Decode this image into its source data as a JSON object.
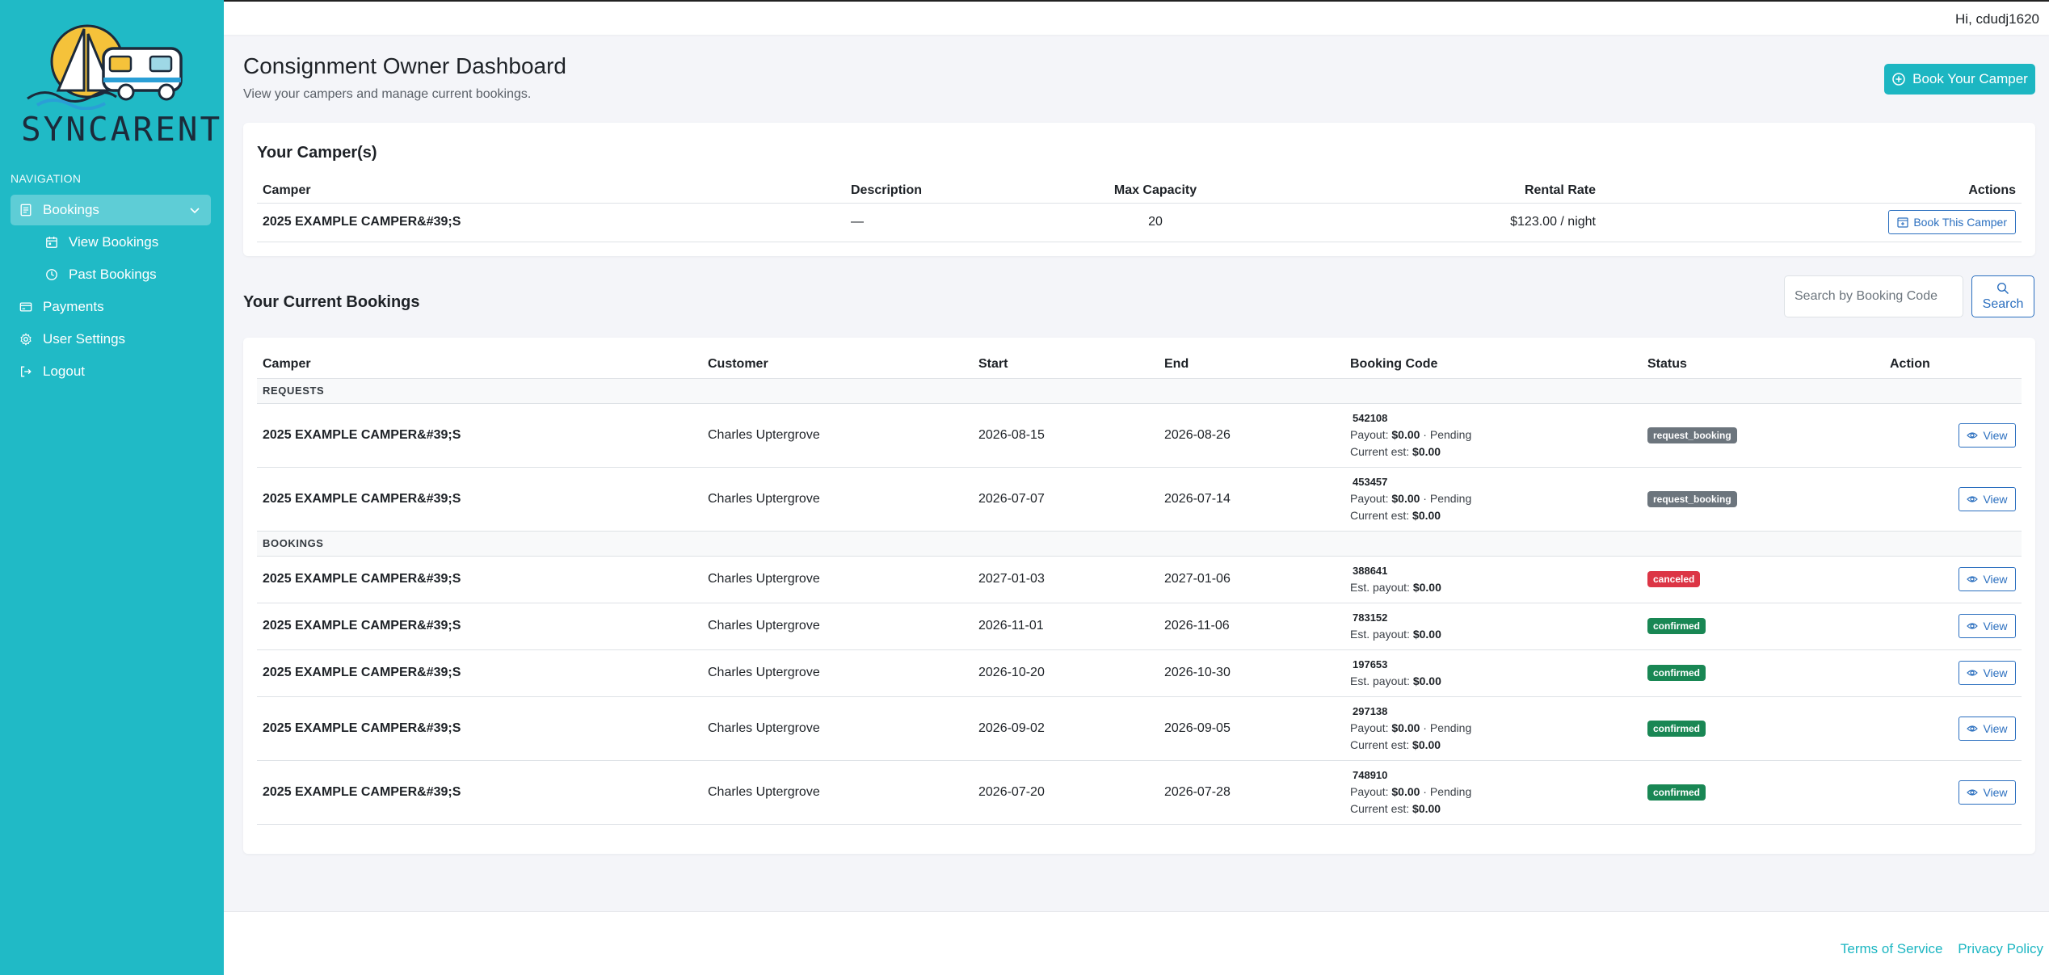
{
  "app": {
    "logo_text": "SYNCARENT",
    "greeting": "Hi, cdudj1620"
  },
  "colors": {
    "sidebar": "#20bac6",
    "accent": "#1cb6c2",
    "link_outline": "#2b6fbf",
    "status_request": "#6c757d",
    "status_canceled": "#dc3545",
    "status_confirmed": "#198754"
  },
  "sidebar": {
    "heading": "NAVIGATION",
    "items": [
      {
        "label": "Bookings",
        "icon": "bookings-icon",
        "active": true,
        "expanded": true
      },
      {
        "label": "View Bookings",
        "icon": "calendar-icon",
        "sub": true
      },
      {
        "label": "Past Bookings",
        "icon": "clock-icon",
        "sub": true
      },
      {
        "label": "Payments",
        "icon": "credit-card-icon"
      },
      {
        "label": "User Settings",
        "icon": "gear-icon"
      },
      {
        "label": "Logout",
        "icon": "logout-icon"
      }
    ]
  },
  "header": {
    "title": "Consignment Owner Dashboard",
    "subtitle": "View your campers and manage current bookings.",
    "book_button": "Book Your Camper",
    "book_button_icon": "plus-circle-icon"
  },
  "campers": {
    "title": "Your Camper(s)",
    "columns": [
      "Camper",
      "Description",
      "Max Capacity",
      "Rental Rate",
      "Actions"
    ],
    "rows": [
      {
        "camper": "2025 EXAMPLE CAMPER&#39;S",
        "description": "—",
        "capacity": "20",
        "rate": "$123.00 / night",
        "action": "Book This Camper"
      }
    ]
  },
  "bookings": {
    "title": "Your Current Bookings",
    "search_placeholder": "Search by Booking Code",
    "search_button": "Search",
    "columns": [
      "Camper",
      "Customer",
      "Start",
      "End",
      "Booking Code",
      "Status",
      "Action"
    ],
    "groups": {
      "requests": "REQUESTS",
      "bookings": "BOOKINGS"
    },
    "view_label": "View",
    "requests": [
      {
        "camper": "2025 EXAMPLE CAMPER&#39;S",
        "customer": "Charles Uptergrove",
        "start": "2026-08-15",
        "end": "2026-08-26",
        "code": "542108",
        "payout_label": "Payout:",
        "payout": "$0.00",
        "payout_note": " · Pending",
        "est_label": "Current est:",
        "est": "$0.00",
        "status": "request_booking"
      },
      {
        "camper": "2025 EXAMPLE CAMPER&#39;S",
        "customer": "Charles Uptergrove",
        "start": "2026-07-07",
        "end": "2026-07-14",
        "code": "453457",
        "payout_label": "Payout:",
        "payout": "$0.00",
        "payout_note": " · Pending",
        "est_label": "Current est:",
        "est": "$0.00",
        "status": "request_booking"
      }
    ],
    "booked": [
      {
        "camper": "2025 EXAMPLE CAMPER&#39;S",
        "customer": "Charles Uptergrove",
        "start": "2027-01-03",
        "end": "2027-01-06",
        "code": "388641",
        "est_label": "Est. payout:",
        "est": "$0.00",
        "status": "canceled"
      },
      {
        "camper": "2025 EXAMPLE CAMPER&#39;S",
        "customer": "Charles Uptergrove",
        "start": "2026-11-01",
        "end": "2026-11-06",
        "code": "783152",
        "est_label": "Est. payout:",
        "est": "$0.00",
        "status": "confirmed"
      },
      {
        "camper": "2025 EXAMPLE CAMPER&#39;S",
        "customer": "Charles Uptergrove",
        "start": "2026-10-20",
        "end": "2026-10-30",
        "code": "197653",
        "est_label": "Est. payout:",
        "est": "$0.00",
        "status": "confirmed"
      },
      {
        "camper": "2025 EXAMPLE CAMPER&#39;S",
        "customer": "Charles Uptergrove",
        "start": "2026-09-02",
        "end": "2026-09-05",
        "code": "297138",
        "payout_label": "Payout:",
        "payout": "$0.00",
        "payout_note": " · Pending",
        "est_label": "Current est:",
        "est": "$0.00",
        "status": "confirmed"
      },
      {
        "camper": "2025 EXAMPLE CAMPER&#39;S",
        "customer": "Charles Uptergrove",
        "start": "2026-07-20",
        "end": "2026-07-28",
        "code": "748910",
        "payout_label": "Payout:",
        "payout": "$0.00",
        "payout_note": " · Pending",
        "est_label": "Current est:",
        "est": "$0.00",
        "status": "confirmed"
      }
    ]
  },
  "footer": {
    "terms": "Terms of Service",
    "privacy": "Privacy Policy"
  }
}
